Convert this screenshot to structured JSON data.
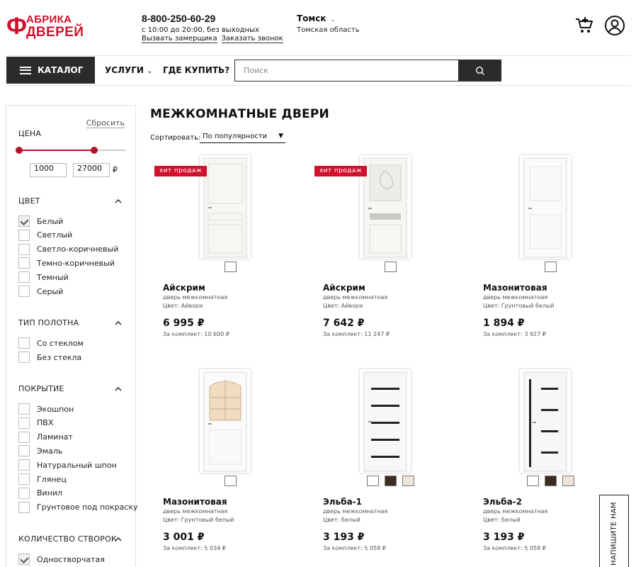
{
  "header": {
    "logo_line1": "АБРИКА",
    "logo_line2": "ДВЕРЕЙ",
    "phone": "8-800-250-60-29",
    "hours": "с 10:00 до 20:00, без выходных",
    "link_measurer": "Вызвать замерщика",
    "link_callback": "Заказать звонок",
    "city": "Томск",
    "region": "Томская область"
  },
  "nav": {
    "catalog": "КАТАЛОГ",
    "services": "УСЛУГИ",
    "where_buy": "ГДЕ КУПИТЬ?",
    "search_placeholder": "Поиск"
  },
  "filters": {
    "reset": "Сбросить",
    "price": {
      "title": "ЦЕНА",
      "min": "1000",
      "max": "27000",
      "currency": "₽"
    },
    "color": {
      "title": "ЦВЕТ",
      "options": [
        {
          "label": "Белый",
          "checked": true
        },
        {
          "label": "Светлый",
          "checked": false
        },
        {
          "label": "Светло-коричневый",
          "checked": false
        },
        {
          "label": "Темно-коричневый",
          "checked": false
        },
        {
          "label": "Темный",
          "checked": false
        },
        {
          "label": "Серый",
          "checked": false
        }
      ]
    },
    "panel": {
      "title": "ТИП ПОЛОТНА",
      "options": [
        {
          "label": "Со стеклом",
          "checked": false
        },
        {
          "label": "Без стекла",
          "checked": false
        }
      ]
    },
    "coating": {
      "title": "ПОКРЫТИЕ",
      "options": [
        {
          "label": "Экошпон",
          "checked": false
        },
        {
          "label": "ПВХ",
          "checked": false
        },
        {
          "label": "Ламинат",
          "checked": false
        },
        {
          "label": "Эмаль",
          "checked": false
        },
        {
          "label": "Натуральный шпон",
          "checked": false
        },
        {
          "label": "Глянец",
          "checked": false
        },
        {
          "label": "Винил",
          "checked": false
        },
        {
          "label": "Грунтовое под покраску",
          "checked": false
        }
      ]
    },
    "leaves": {
      "title": "КОЛИЧЕСТВО СТВОРОК",
      "options": [
        {
          "label": "Одностворчатая",
          "checked": true
        }
      ]
    }
  },
  "main": {
    "title": "МЕЖКОМНАТНЫЕ ДВЕРИ",
    "sort_label": "Сортировать:",
    "sort_value": "По популярности"
  },
  "products": [
    {
      "name": "Айскрим",
      "type": "дверь межкомнатная",
      "color": "Цвет: Айвори",
      "price": "6 995 ₽",
      "set": "За комплект: 10 600 ₽",
      "badge": "хит продаж",
      "swatches": [
        "#ffffff"
      ]
    },
    {
      "name": "Айскрим",
      "type": "дверь межкомнатная",
      "color": "Цвет: Айвори",
      "price": "7 642 ₽",
      "set": "За комплект: 11 247 ₽",
      "badge": "хит продаж",
      "swatches": [
        "#ffffff"
      ]
    },
    {
      "name": "Мазонитовая",
      "type": "дверь межкомнатная",
      "color": "Цвет: Грунтовый белый",
      "price": "1 894 ₽",
      "set": "За комплект: 3 927 ₽",
      "badge": "",
      "swatches": [
        "#ffffff"
      ]
    },
    {
      "name": "Мазонитовая",
      "type": "дверь межкомнатная",
      "color": "Цвет: Грунтовый белый",
      "price": "3 001 ₽",
      "set": "За комплект: 5 034 ₽",
      "badge": "",
      "swatches": [
        "#ffffff"
      ]
    },
    {
      "name": "Эльба-1",
      "type": "дверь межкомнатная",
      "color": "Цвет: Белый",
      "price": "3 193 ₽",
      "set": "За комплект: 5 058 ₽",
      "badge": "",
      "swatches": [
        "#ffffff",
        "#3d2a22",
        "#ece4da"
      ]
    },
    {
      "name": "Эльба-2",
      "type": "дверь межкомнатная",
      "color": "Цвет: Белый",
      "price": "3 193 ₽",
      "set": "За комплект: 5 058 ₽",
      "badge": "",
      "swatches": [
        "#ffffff",
        "#3d2a22",
        "#ece4da"
      ]
    }
  ],
  "write_us": "НАПИШИТЕ НАМ",
  "colors": {
    "brand_red": "#d0112b",
    "dark": "#2b2b2b",
    "slider": "#b1122a"
  }
}
